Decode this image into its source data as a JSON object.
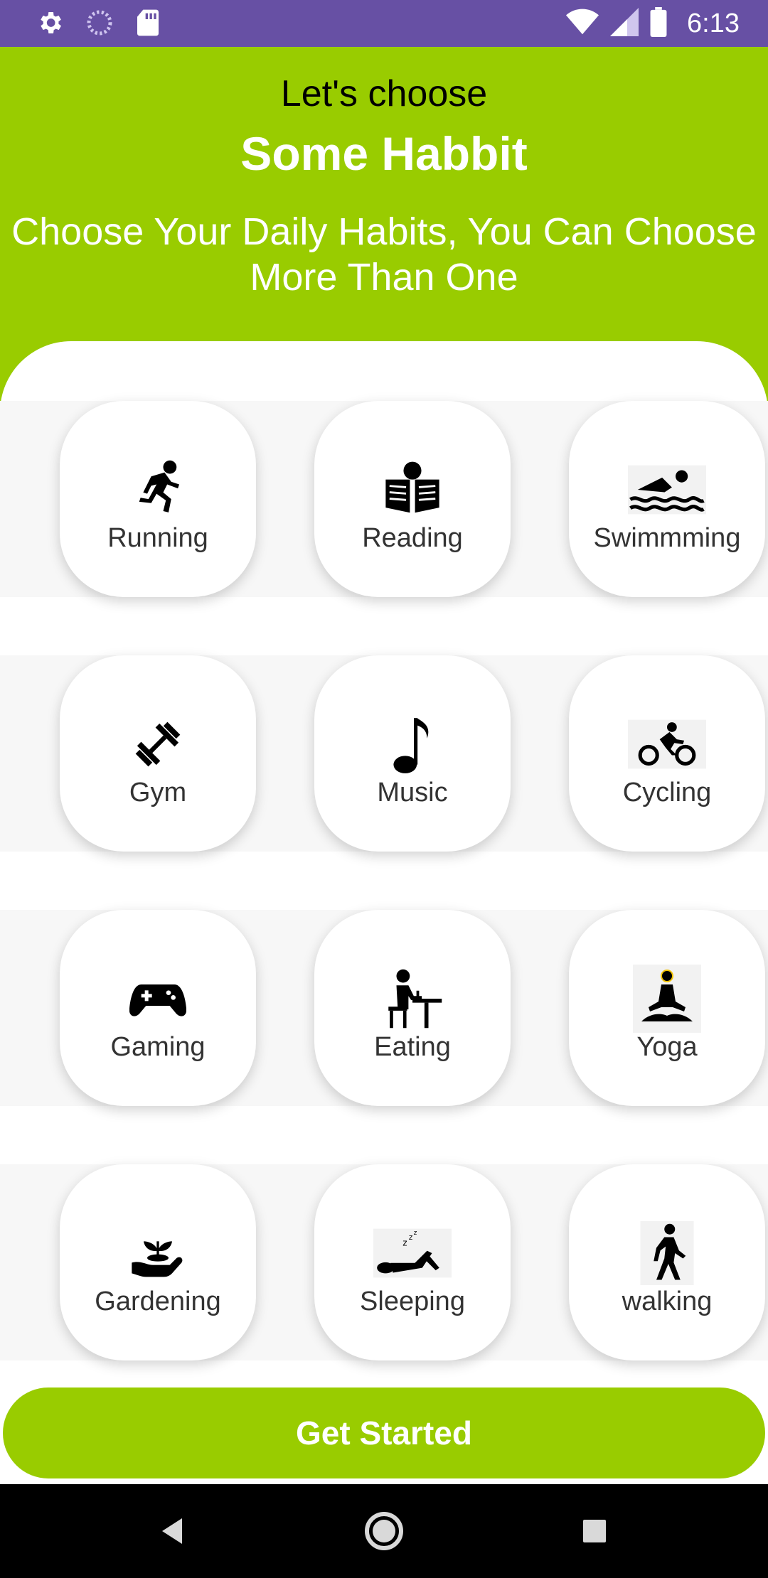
{
  "status_bar": {
    "time": "6:13",
    "left_icons": [
      "settings-icon",
      "loading-icon",
      "sd-card-icon"
    ],
    "right_icons": [
      "wifi-icon",
      "signal-icon",
      "battery-icon"
    ],
    "color": "#6750a4"
  },
  "header": {
    "line1": "Let's choose",
    "line2": "Some Habbit",
    "subtitle": "Choose Your Daily Habits, You Can Choose More Than One",
    "color": "#99cc00"
  },
  "habits": [
    {
      "label": "Running",
      "icon": "running-icon"
    },
    {
      "label": "Reading",
      "icon": "reading-icon"
    },
    {
      "label": "Swimmming",
      "icon": "swimming-icon"
    },
    {
      "label": "Gym",
      "icon": "dumbbell-icon"
    },
    {
      "label": "Music",
      "icon": "music-note-icon"
    },
    {
      "label": "Cycling",
      "icon": "cycling-icon"
    },
    {
      "label": "Gaming",
      "icon": "gamepad-icon"
    },
    {
      "label": "Eating",
      "icon": "eating-icon"
    },
    {
      "label": "Yoga",
      "icon": "yoga-icon"
    },
    {
      "label": "Gardening",
      "icon": "gardening-icon"
    },
    {
      "label": "Sleeping",
      "icon": "sleeping-icon"
    },
    {
      "label": "walking",
      "icon": "walking-icon"
    }
  ],
  "cta": {
    "label": "Get Started",
    "color": "#99cc00"
  },
  "nav_bar": {
    "buttons": [
      "back-icon",
      "home-icon",
      "recents-icon"
    ]
  }
}
